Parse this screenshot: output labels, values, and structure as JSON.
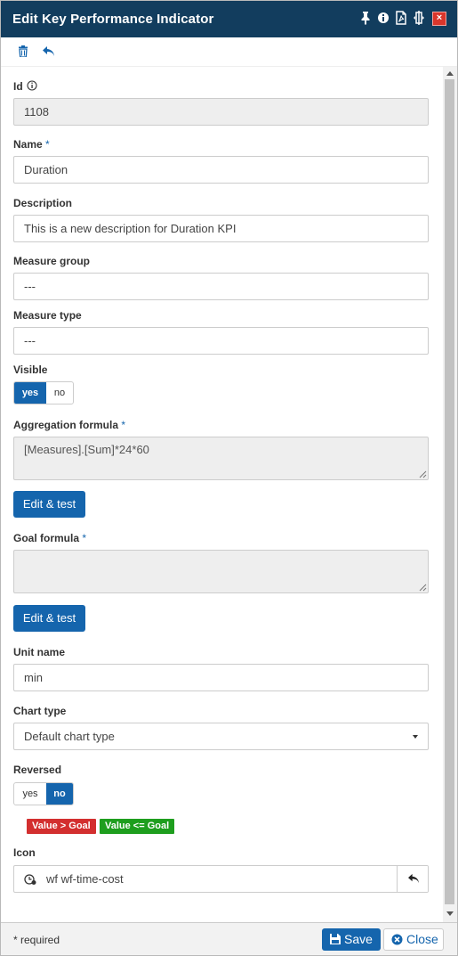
{
  "window": {
    "title": "Edit Key Performance Indicator",
    "close_glyph": "×"
  },
  "toolbar": {
    "icons": [
      "trash-icon",
      "undo-icon"
    ]
  },
  "form": {
    "id": {
      "label": "Id",
      "value": "1108"
    },
    "name": {
      "label": "Name",
      "required_mark": "*",
      "value": "Duration"
    },
    "description": {
      "label": "Description",
      "value": "This is a new description for Duration KPI"
    },
    "measure_group": {
      "label": "Measure group",
      "value": "---"
    },
    "measure_type": {
      "label": "Measure type",
      "value": "---"
    },
    "visible": {
      "label": "Visible",
      "yes": "yes",
      "no": "no",
      "selected": "yes"
    },
    "aggregation_formula": {
      "label": "Aggregation formula",
      "required_mark": "*",
      "value": "[Measures].[Sum]*24*60",
      "button": "Edit & test"
    },
    "goal_formula": {
      "label": "Goal formula",
      "required_mark": "*",
      "value": "",
      "button": "Edit & test"
    },
    "unit_name": {
      "label": "Unit name",
      "value": "min"
    },
    "chart_type": {
      "label": "Chart type",
      "value": "Default chart type"
    },
    "reversed": {
      "label": "Reversed",
      "yes": "yes",
      "no": "no",
      "selected": "no"
    },
    "legend": {
      "above": {
        "text": "Value > Goal",
        "color": "#d32f2f"
      },
      "below": {
        "text": "Value <= Goal",
        "color": "#1e9e1e"
      }
    },
    "icon": {
      "label": "Icon",
      "value": "wf wf-time-cost"
    }
  },
  "footer": {
    "required_note": "* required",
    "save": "Save",
    "close": "Close"
  },
  "colors": {
    "titlebar": "#123d5e",
    "accent": "#1565ad",
    "close": "#d9362c"
  }
}
